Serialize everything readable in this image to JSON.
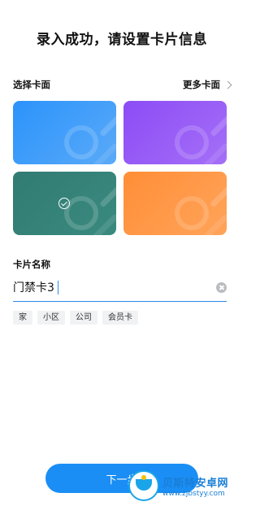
{
  "page": {
    "title": "录入成功，请设置卡片信息"
  },
  "card_face": {
    "label": "选择卡面",
    "more_label": "更多卡面",
    "cards": [
      {
        "color_from": "#2b93fb",
        "color_to": "#5aaaf8",
        "selected": false
      },
      {
        "color_from": "#8c4cf6",
        "color_to": "#a56ff7",
        "selected": false
      },
      {
        "color_from": "#317b72",
        "color_to": "#3a8a80",
        "selected": true
      },
      {
        "color_from": "#ff8e37",
        "color_to": "#ffa45a",
        "selected": false
      }
    ]
  },
  "card_name": {
    "label": "卡片名称",
    "value": "门禁卡3",
    "tags": [
      "家",
      "小区",
      "公司",
      "会员卡"
    ]
  },
  "footer": {
    "next_label": "下一步"
  },
  "watermark": {
    "name": "贝斯特安卓网",
    "url": "www.zjbstyy.com"
  },
  "colors": {
    "accent": "#1a8ef5"
  }
}
